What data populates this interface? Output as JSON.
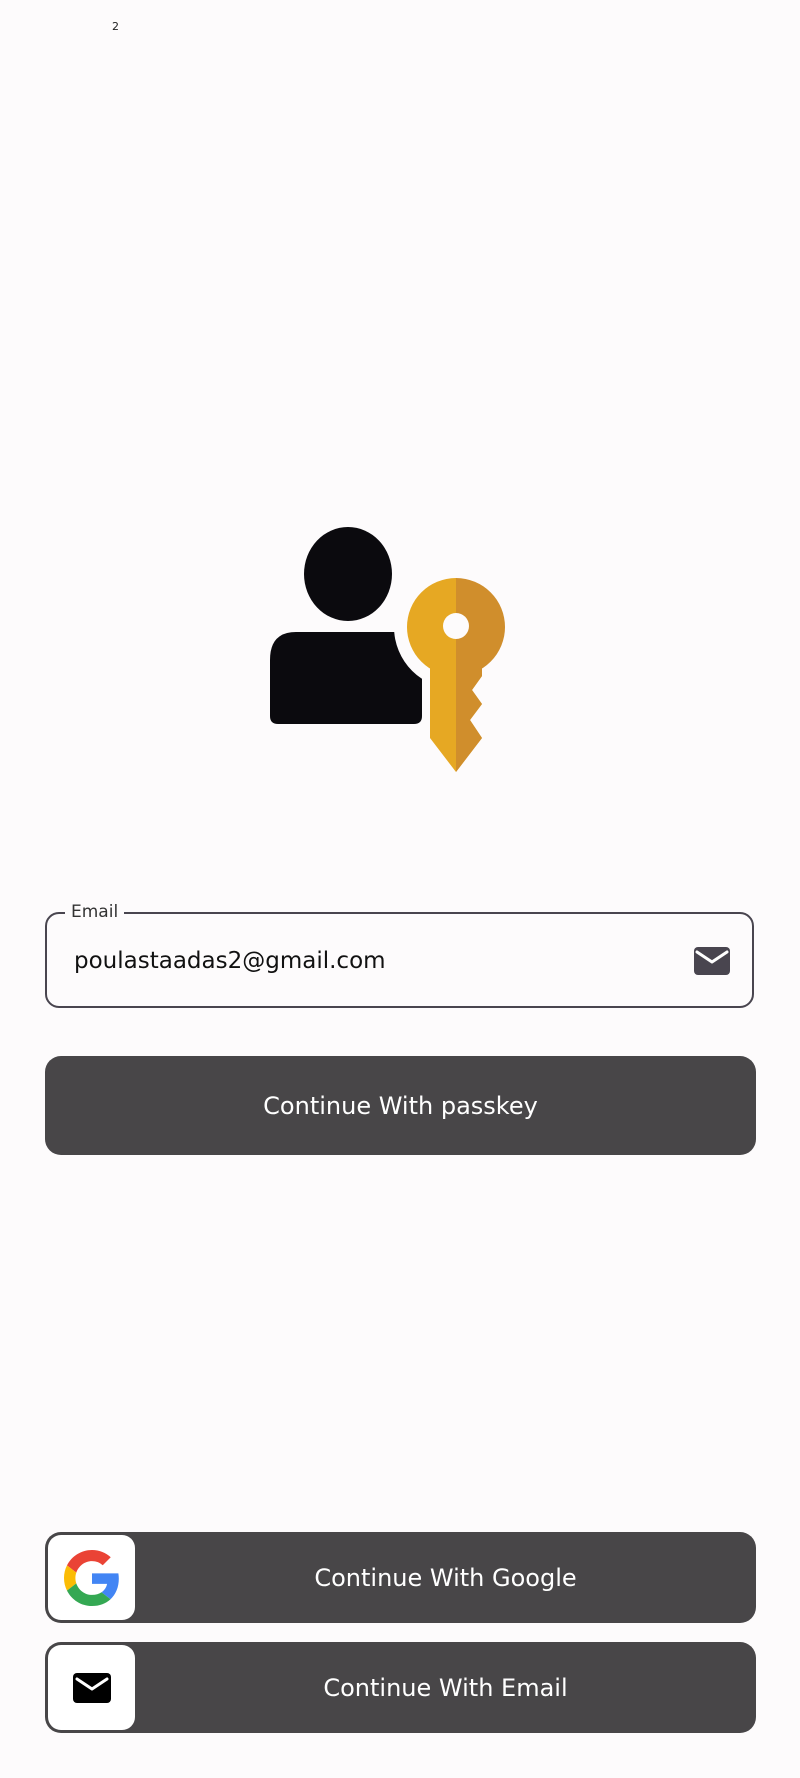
{
  "status_bar": {
    "text": "2"
  },
  "email_field": {
    "label": "Email",
    "value": "poulastaadas2@gmail.com"
  },
  "buttons": {
    "passkey": "Continue With passkey",
    "google": "Continue With Google",
    "email": "Continue With Email"
  },
  "icons": {
    "hero": "user-key-icon",
    "field": "mail-icon",
    "google": "google-g-icon",
    "email": "mail-icon"
  },
  "colors": {
    "background": "#fdfbfc",
    "button": "#484648",
    "key": "#e6a823",
    "key_shade": "#d08e2c",
    "user": "#0b0a0e"
  }
}
